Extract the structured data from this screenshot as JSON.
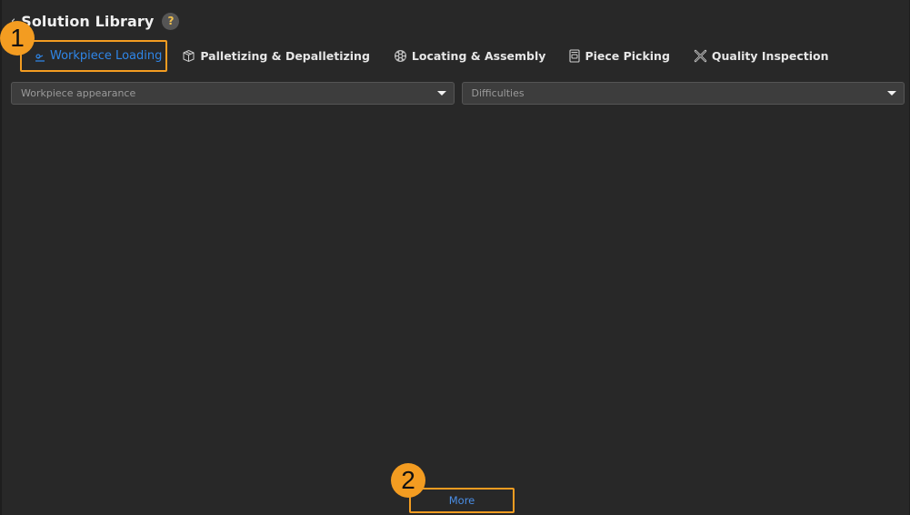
{
  "header": {
    "back_icon": "‹",
    "title": "Solution Library",
    "help_icon": "?"
  },
  "tabs": [
    {
      "label": "Workpiece Loading",
      "icon": "workpiece-loading-icon",
      "active": true
    },
    {
      "label": "Palletizing & Depalletizing",
      "icon": "box-icon",
      "active": false
    },
    {
      "label": "Locating & Assembly",
      "icon": "gear-wheel-icon",
      "active": false
    },
    {
      "label": "Piece Picking",
      "icon": "bin-icon",
      "active": false
    },
    {
      "label": "Quality Inspection",
      "icon": "tools-icon",
      "active": false
    }
  ],
  "filters": {
    "appearance_placeholder": "Workpiece appearance",
    "difficulties_placeholder": "Difficulties"
  },
  "more_label": "More",
  "annotations": {
    "badge1": "1",
    "badge2": "2"
  },
  "colors": {
    "accent_blue": "#2f86e8",
    "highlight_orange": "#f39c21",
    "background": "#282828"
  }
}
